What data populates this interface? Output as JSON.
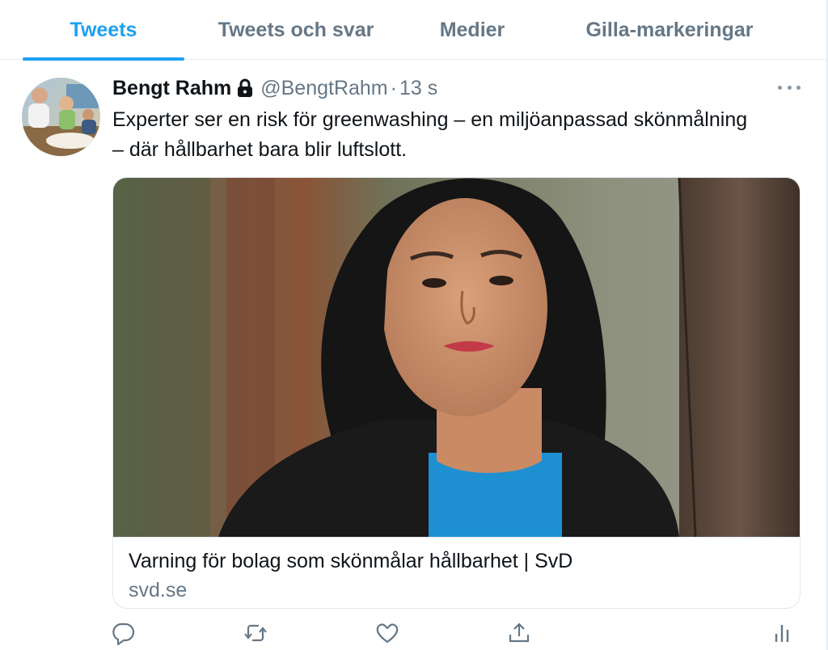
{
  "tabs": [
    {
      "label": "Tweets",
      "active": true
    },
    {
      "label": "Tweets och svar",
      "active": false
    },
    {
      "label": "Medier",
      "active": false
    },
    {
      "label": "Gilla-markeringar",
      "active": false
    }
  ],
  "tweet": {
    "author_name": "Bengt Rahm",
    "author_handle": "@BengtRahm",
    "separator": "·",
    "time": "13 s",
    "text_line1": "Experter ser en risk för greenwashing – en miljöanpassad skönmålning",
    "text_line2": "– där hållbarhet bara blir luftslott.",
    "card": {
      "title": "Varning för bolag som skönmålar hållbarhet | SvD",
      "domain": "svd.se"
    }
  },
  "icons": {
    "lock": "lock-icon",
    "more": "more-icon",
    "reply": "reply-icon",
    "retweet": "retweet-icon",
    "like": "heart-icon",
    "share": "share-icon",
    "analytics": "analytics-icon"
  },
  "colors": {
    "accent": "#1da1f2",
    "text_primary": "#0f1419",
    "text_secondary": "#657786",
    "border": "#e1e8ed",
    "sweater": "#1e90d2"
  }
}
